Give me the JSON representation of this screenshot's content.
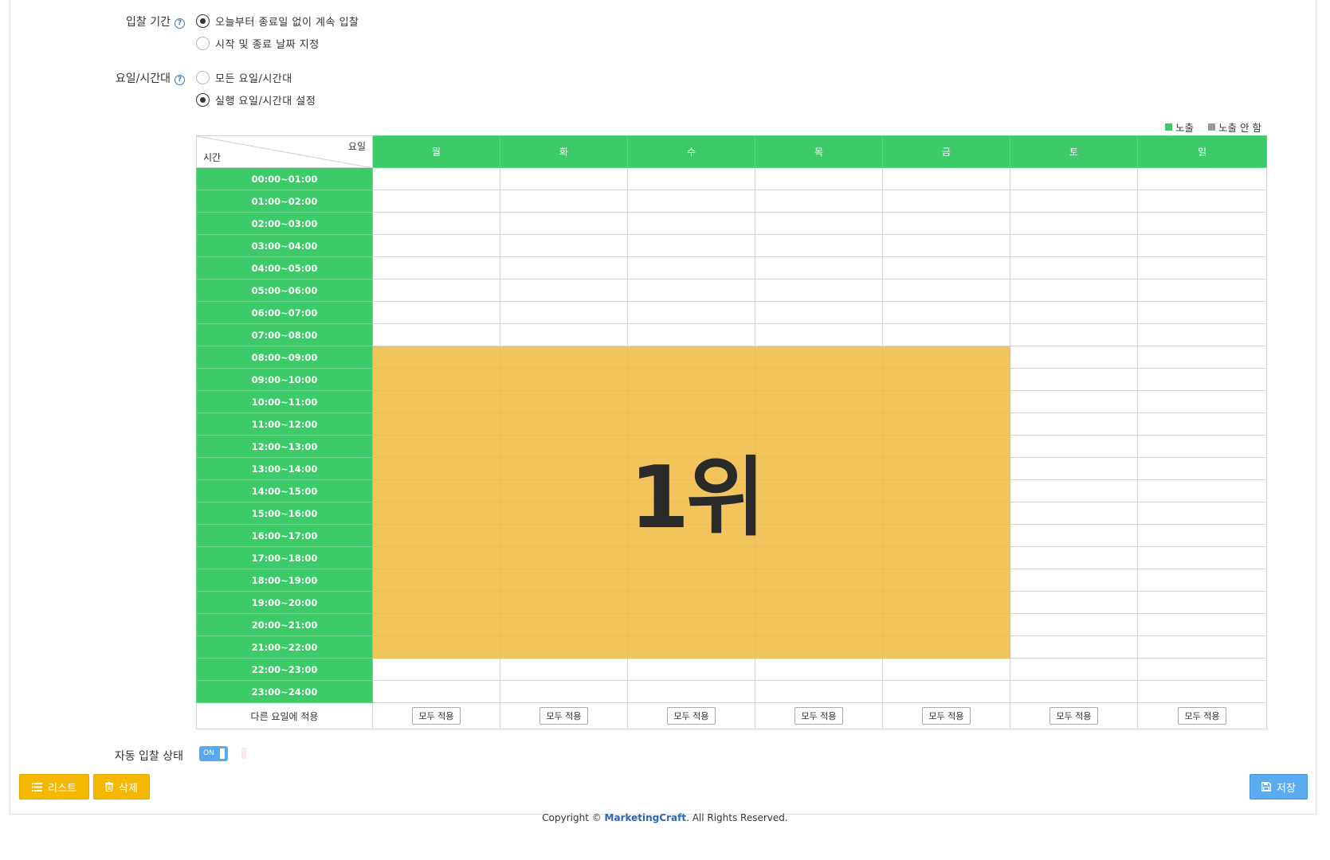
{
  "bid_period": {
    "label": "입찰 기간",
    "options": [
      {
        "text": "오늘부터 종료일 없이 계속 입찰",
        "checked": true
      },
      {
        "text": "시작 및 종료 날짜 지정",
        "checked": false
      }
    ]
  },
  "day_time": {
    "label": "요일/시간대",
    "options": [
      {
        "text": "모든 요일/시간대",
        "checked": false
      },
      {
        "text": "실행 요일/시간대 설정",
        "checked": true
      }
    ]
  },
  "help_glyph": "?",
  "legend": {
    "on_label": "노출",
    "off_label": "노출 안 함",
    "on_color": "#3ccb68",
    "off_color": "#999999"
  },
  "schedule": {
    "corner_day": "요일",
    "corner_time": "시간",
    "days": [
      "월",
      "화",
      "수",
      "목",
      "금",
      "토",
      "일"
    ],
    "times": [
      "00:00~01:00",
      "01:00~02:00",
      "02:00~03:00",
      "03:00~04:00",
      "04:00~05:00",
      "05:00~06:00",
      "06:00~07:00",
      "07:00~08:00",
      "08:00~09:00",
      "09:00~10:00",
      "10:00~11:00",
      "11:00~12:00",
      "12:00~13:00",
      "13:00~14:00",
      "14:00~15:00",
      "15:00~16:00",
      "16:00~17:00",
      "17:00~18:00",
      "18:00~19:00",
      "19:00~20:00",
      "20:00~21:00",
      "21:00~22:00",
      "22:00~23:00",
      "23:00~24:00"
    ],
    "highlight": {
      "days": [
        "월",
        "화",
        "수",
        "목",
        "금"
      ],
      "from": "08:00~09:00",
      "to": "21:00~22:00",
      "color": "#f2c55c"
    },
    "overlay_text": "1위",
    "footer_label": "다른 요일에 적용",
    "apply_all_label": "모두 적용"
  },
  "auto_bid": {
    "label": "자동 입찰 상태",
    "toggle_text": "ON",
    "state": true
  },
  "buttons": {
    "list": "리스트",
    "delete": "삭제",
    "save": "저장"
  },
  "footer": {
    "prefix": "Copyright ©",
    "brand": "MarketingCraft",
    "suffix": ". All Rights Reserved."
  }
}
